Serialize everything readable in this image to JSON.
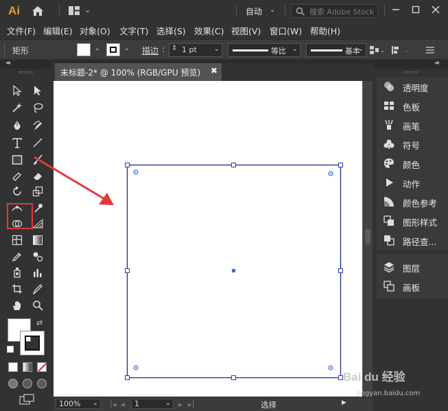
{
  "app": {
    "logo": "Ai",
    "workspace": "自动",
    "search_placeholder": "搜索 Adobe Stock"
  },
  "menu": [
    "文件(F)",
    "编辑(E)",
    "对象(O)",
    "文字(T)",
    "选择(S)",
    "效果(C)",
    "视图(V)",
    "窗口(W)",
    "帮助(H)"
  ],
  "control": {
    "tool_name": "矩形",
    "stroke_label": "描边",
    "stroke_sep": ":",
    "stroke_value": "1 pt",
    "profile_label": "等比",
    "brush_label": "基本"
  },
  "document": {
    "tab_title": "未标题-2* @ 100% (RGB/GPU 预览)",
    "close": "✖"
  },
  "status": {
    "zoom": "100%",
    "page": "1",
    "mode": "选择"
  },
  "panels": [
    {
      "label": "透明度",
      "icon": "transparency-icon"
    },
    {
      "label": "色板",
      "icon": "swatches-icon"
    },
    {
      "label": "画笔",
      "icon": "brush-icon"
    },
    {
      "label": "符号",
      "icon": "symbols-icon"
    },
    {
      "label": "颜色",
      "icon": "color-icon"
    },
    {
      "label": "动作",
      "icon": "actions-icon"
    },
    {
      "label": "颜色参考",
      "icon": "color-guide-icon"
    },
    {
      "label": "图形样式",
      "icon": "graphic-styles-icon"
    },
    {
      "label": "路径查...",
      "icon": "pathfinder-icon"
    }
  ],
  "panels2": [
    {
      "label": "图层",
      "icon": "layers-icon"
    },
    {
      "label": "画板",
      "icon": "artboards-icon"
    }
  ],
  "watermark": {
    "brand": "Bai du 经验",
    "url": "jingyan.baidu.com"
  },
  "colors": {
    "selection": "#1c2a7d",
    "annotation": "#e3393c",
    "accent": "#f0982a"
  }
}
